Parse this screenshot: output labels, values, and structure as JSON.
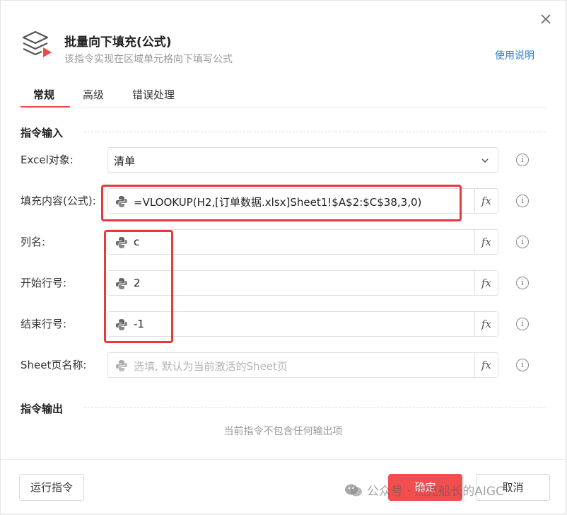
{
  "header": {
    "title": "批量向下填充(公式)",
    "subtitle": "该指令实现在区域单元格向下填写公式",
    "help_link": "使用说明"
  },
  "tabs": [
    {
      "label": "常规",
      "active": true
    },
    {
      "label": "高级",
      "active": false
    },
    {
      "label": "错误处理",
      "active": false
    }
  ],
  "input_section": {
    "title": "指令输入",
    "fields": [
      {
        "label": "Excel对象:",
        "value": "清单",
        "kind": "select"
      },
      {
        "label": "填充内容(公式):",
        "value": "=VLOOKUP(H2,[订单数据.xlsx]Sheet1!$A$2:$C$38,3,0)",
        "kind": "expression"
      },
      {
        "label": "列名:",
        "value": "c",
        "kind": "expression"
      },
      {
        "label": "开始行号:",
        "value": "2",
        "kind": "expression"
      },
      {
        "label": "结束行号:",
        "value": "-1",
        "kind": "expression"
      },
      {
        "label": "Sheet页名称:",
        "value": "",
        "placeholder": "选填, 默认为当前激活的Sheet页",
        "kind": "expression"
      }
    ],
    "fx_label": "fx",
    "info_glyph": "i"
  },
  "output_section": {
    "title": "指令输出",
    "empty_text": "当前指令不包含任何输出项"
  },
  "footer": {
    "run_label": "运行指令",
    "ok_label": "确定",
    "cancel_label": "取消"
  },
  "watermark": "公众号 · 杰克船长的AIGC",
  "colors": {
    "accent": "#f24e50",
    "highlight": "#e8373d",
    "link": "#2f7fd8"
  },
  "icons": [
    "layers-logo-icon",
    "close-icon",
    "chevron-down-icon",
    "python-icon",
    "fx-icon",
    "info-icon",
    "wechat-icon"
  ]
}
